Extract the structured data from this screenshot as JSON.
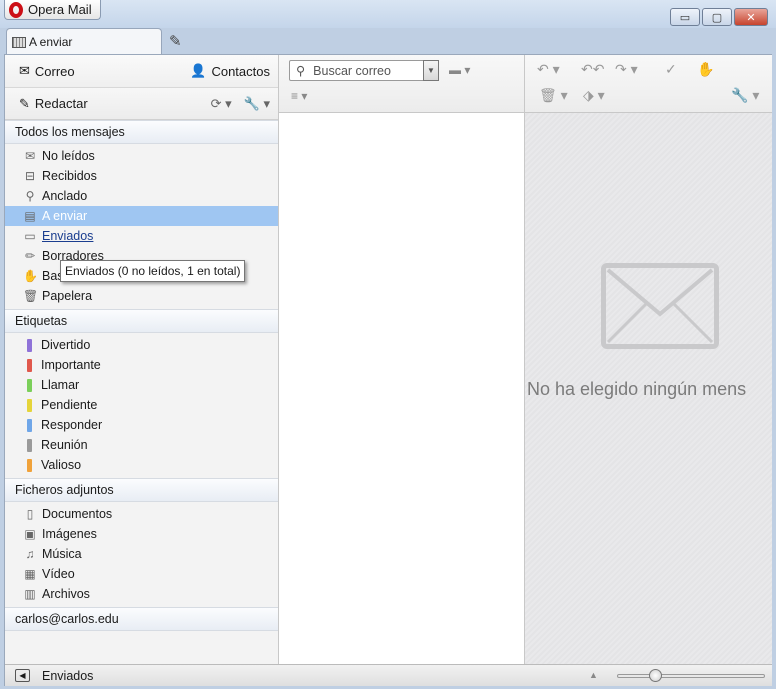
{
  "window": {
    "app_title": "Opera Mail",
    "minimize": "▭",
    "maximize": "▢",
    "close": "✕"
  },
  "tabs": {
    "active_label": "A enviar"
  },
  "sidebar": {
    "mail_label": "Correo",
    "contacts_label": "Contactos",
    "compose_label": "Redactar",
    "all_messages": "Todos los mensajes",
    "mail_items": [
      {
        "label": "No leídos",
        "icon": "envelope-icon"
      },
      {
        "label": "Recibidos",
        "icon": "inbox-icon"
      },
      {
        "label": "Anclado",
        "icon": "pin-icon"
      },
      {
        "label": "A enviar",
        "icon": "outbox-icon"
      },
      {
        "label": "Enviados",
        "icon": "sent-icon"
      },
      {
        "label": "Borradores",
        "icon": "pencil-icon"
      },
      {
        "label": "Basura",
        "icon": "hand-icon"
      },
      {
        "label": "Papelera",
        "icon": "trash-icon"
      }
    ],
    "labels_title": "Etiquetas",
    "label_items": [
      {
        "label": "Divertido",
        "color": "#8f72d8"
      },
      {
        "label": "Importante",
        "color": "#e0584c"
      },
      {
        "label": "Llamar",
        "color": "#7bcf5a"
      },
      {
        "label": "Pendiente",
        "color": "#e5d43a"
      },
      {
        "label": "Responder",
        "color": "#6fa6e8"
      },
      {
        "label": "Reunión",
        "color": "#9a9a9a"
      },
      {
        "label": "Valioso",
        "color": "#f0a23a"
      }
    ],
    "attachments_title": "Ficheros adjuntos",
    "attachment_items": [
      {
        "label": "Documentos",
        "icon": "document-icon"
      },
      {
        "label": "Imágenes",
        "icon": "image-icon"
      },
      {
        "label": "Música",
        "icon": "music-icon"
      },
      {
        "label": "Vídeo",
        "icon": "video-icon"
      },
      {
        "label": "Archivos",
        "icon": "archive-icon"
      }
    ],
    "account": "carlos@carlos.edu"
  },
  "message_list": {
    "search_placeholder": "Buscar correo"
  },
  "reader": {
    "empty_text": "No ha elegido ningún mens"
  },
  "tooltip": "Enviados (0 no leídos, 1 en total)",
  "status": {
    "text": "Enviados"
  }
}
